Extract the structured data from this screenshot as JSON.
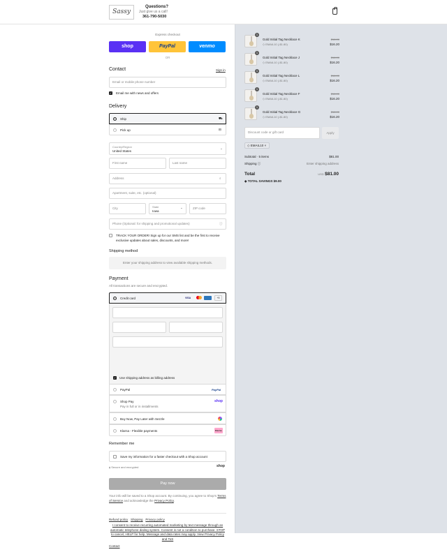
{
  "header": {
    "logo_text": "Sassy",
    "questions": "Questions?",
    "subtitle": "Just give us a call!",
    "phone": "361-790-5030"
  },
  "express": {
    "title": "Express checkout",
    "shop": "shop",
    "paypal": "PayPal",
    "venmo": "venmo",
    "or": "OR"
  },
  "contact": {
    "title": "Contact",
    "sign_in": "Sign in",
    "placeholder": "Email or mobile phone number",
    "news_label": "Email me with news and offers"
  },
  "delivery": {
    "title": "Delivery",
    "ship": "Ship",
    "pickup": "Pick up",
    "country_label": "Country/Region",
    "country_value": "United States",
    "first_name": "First name",
    "last_name": "Last name",
    "address": "Address",
    "apartment": "Apartment, suite, etc. (optional)",
    "city": "City",
    "state_label": "State",
    "state_value": "Iowa",
    "zip": "ZIP code",
    "phone": "Phone (Optional: for shipping and promotional updates)",
    "sms": "TRACK YOUR ORDER! Sign up for our SMS list and be the first to receive exclusive updates about sales, discounts, and more!"
  },
  "shipping_method": {
    "title": "Shipping method",
    "note": "Enter your shipping address to view available shipping methods."
  },
  "payment": {
    "title": "Payment",
    "subtitle": "All transactions are secure and encrypted.",
    "credit_card": "Credit card",
    "billing_same": "Use shipping address as billing address",
    "paypal": "PayPal",
    "paypal_logo": "PayPal",
    "shop_pay": "Shop Pay",
    "shop_pay_sub": "Pay in full or in installments",
    "shop_logo": "shop",
    "sezzle": "Buy Now, Pay Later with Sezzle",
    "klarna": "Klarna - Flexible payments",
    "klarna_logo": "Klarna.",
    "card_more": "+5",
    "card_visa": "VISA"
  },
  "remember": {
    "title": "Remember me",
    "save_label": "Save my information for a faster checkout with a Shop account",
    "secure": "Secure and encrypted",
    "shop_logo": "shop"
  },
  "pay_now": "Pay now",
  "legal": {
    "line1": "Your info will be saved to a Shop account. By continuing, you agree to Shop's",
    "terms": "Terms of Service",
    "and": "and acknowledge the",
    "privacy": "Privacy Policy",
    "period": "."
  },
  "footer": {
    "refund": "Refund policy",
    "shipping": "Shipping",
    "privacy": "Privacy policy",
    "consent": "I consent to receive recurring automated marketing by text message through an automatic telephone dialing system. Consent is not a condition to purchase. STOP to cancel, HELP for help. Message and data rates may apply. View Privacy Policy and ToS",
    "contact": "Contact"
  },
  "summary": {
    "items": [
      {
        "qty": "1",
        "name": "Gold Initial Tag Necklace K",
        "discount": "EMAIL10 (-$1.80)",
        "old_price": "$18.00",
        "price": "$16.20"
      },
      {
        "qty": "1",
        "name": "Gold Initial Tag Necklace J",
        "discount": "EMAIL10 (-$1.80)",
        "old_price": "$18.00",
        "price": "$16.20"
      },
      {
        "qty": "1",
        "name": "Gold Initial Tag Necklace L",
        "discount": "EMAIL10 (-$1.80)",
        "old_price": "$18.00",
        "price": "$16.20"
      },
      {
        "qty": "1",
        "name": "Gold Initial Tag Necklace F",
        "discount": "EMAIL10 (-$1.80)",
        "old_price": "$18.00",
        "price": "$16.20"
      },
      {
        "qty": "1",
        "name": "Gold Initial Tag Necklace G",
        "discount": "EMAIL10 (-$1.80)",
        "old_price": "$18.00",
        "price": "$16.20"
      }
    ],
    "discount_placeholder": "Discount code or gift card",
    "apply": "Apply",
    "code_tag": "EMAIL10",
    "subtotal_label": "Subtotal · 5 items",
    "subtotal_value": "$81.00",
    "shipping_label": "Shipping",
    "shipping_value": "Enter shipping address",
    "total_label": "Total",
    "currency": "USD",
    "total_value": "$81.00",
    "savings": "TOTAL SAVINGS $9.00"
  }
}
